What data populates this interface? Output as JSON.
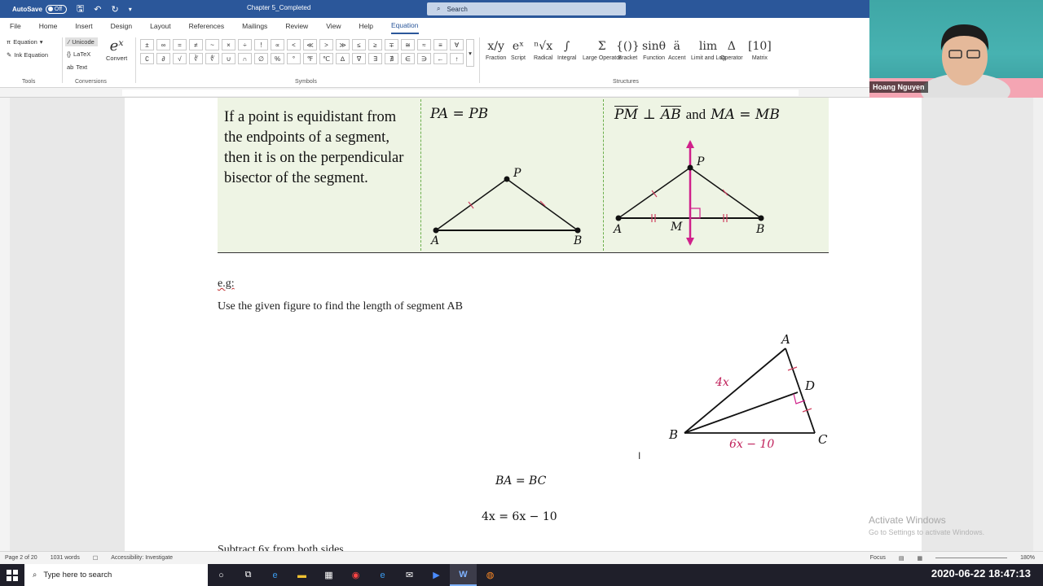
{
  "titlebar": {
    "autosave_label": "AutoSave",
    "autosave_state": "Off",
    "doc_title": "Chapter 5_Completed",
    "search_placeholder": "Search"
  },
  "tabs": [
    "File",
    "Home",
    "Insert",
    "Design",
    "Layout",
    "References",
    "Mailings",
    "Review",
    "View",
    "Help",
    "Equation"
  ],
  "ribbon": {
    "tools": {
      "equation": "Equation",
      "ink_equation": "Ink Equation",
      "label": "Tools"
    },
    "conversions": {
      "unicode": "Unicode",
      "latex": "LaTeX",
      "text": "Text",
      "convert": "Convert",
      "label": "Conversions"
    },
    "symbols_label": "Symbols",
    "symbols": [
      "±",
      "∞",
      "=",
      "≠",
      "~",
      "×",
      "÷",
      "!",
      "∝",
      "<",
      "≪",
      ">",
      "≫",
      "≤",
      "≥",
      "∓",
      "≅",
      "≈",
      "≡",
      "∀",
      "∁",
      "∂",
      "√",
      "∛",
      "∜",
      "∪",
      "∩",
      "∅",
      "%",
      "°",
      "℉",
      "℃",
      "∆",
      "∇",
      "∃",
      "∄",
      "∈",
      "∋",
      "←",
      "↑"
    ],
    "structures_label": "Structures",
    "structures": [
      {
        "glyph": "x/y",
        "label": "Fraction"
      },
      {
        "glyph": "eˣ",
        "label": "Script"
      },
      {
        "glyph": "ⁿ√x",
        "label": "Radical"
      },
      {
        "glyph": "∫",
        "label": "Integral"
      },
      {
        "glyph": "Σ",
        "label": "Large Operator"
      },
      {
        "glyph": "{()}",
        "label": "Bracket"
      },
      {
        "glyph": "sinθ",
        "label": "Function"
      },
      {
        "glyph": "ä",
        "label": "Accent"
      },
      {
        "glyph": "lim",
        "label": "Limit and Log"
      },
      {
        "glyph": "Δ",
        "label": "Operator"
      },
      {
        "glyph": "[10]",
        "label": "Matrix"
      }
    ]
  },
  "document": {
    "theorem_text": "If a point is equidistant from the endpoints of a segment, then it is on the perpendicular bisector of the segment.",
    "mid_header": "PA = PB",
    "right_header_pm": "PM",
    "right_header_perp": "⊥",
    "right_header_ab": "AB",
    "right_header_and": "and",
    "right_header_eq": "MA = MB",
    "labels": {
      "A": "A",
      "B": "B",
      "P": "P",
      "M": "M",
      "C": "C",
      "D": "D"
    },
    "eg": "e.g:",
    "prompt": "Use the given figure to find the length of segment AB",
    "figure_ab": "4x",
    "figure_bc": "6x − 10",
    "eq1": "BA = BC",
    "eq2": "4x = 6x − 10",
    "cut_line": "Subtract 6x from both sides"
  },
  "watermark": {
    "title": "Activate Windows",
    "sub": "Go to Settings to activate Windows."
  },
  "statusbar": {
    "page": "Page 2 of 20",
    "words": "1031 words",
    "accessibility": "Accessibility: Investigate",
    "focus": "Focus",
    "zoom": "180%"
  },
  "webcam": {
    "name": "Hoang Nguyen"
  },
  "taskbar": {
    "search": "Type here to search",
    "datetime": "2020-06-22  18:47:13"
  }
}
